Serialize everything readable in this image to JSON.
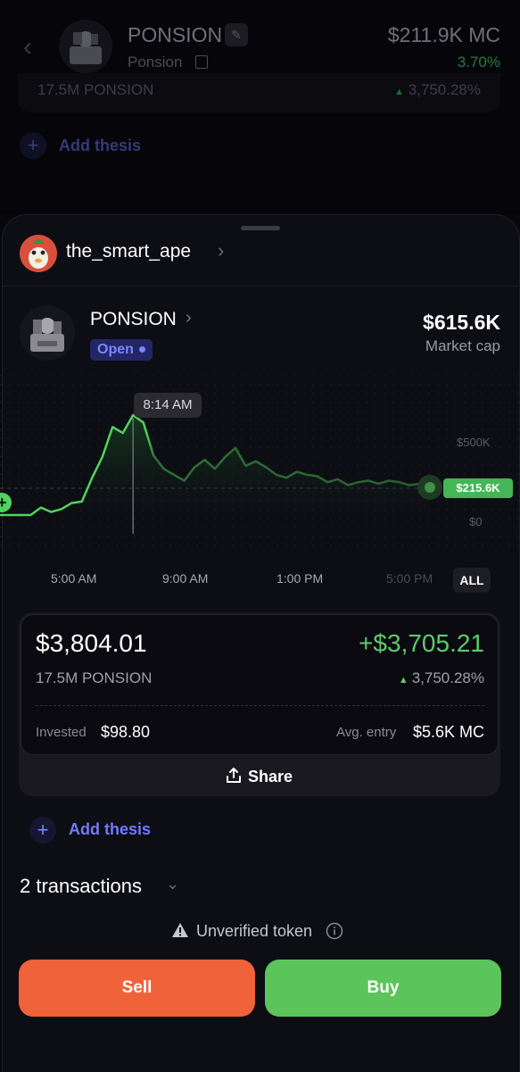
{
  "background": {
    "token_name": "PONSION",
    "ticker": "Ponsion",
    "market_cap": "$211.9K MC",
    "change_pct": "3.70%",
    "position_amount": "17.5M PONSION",
    "position_gain": "3,750.28%",
    "add_thesis": "Add thesis"
  },
  "sheet": {
    "username": "the_smart_ape",
    "token": {
      "name": "PONSION",
      "status": "Open",
      "market_cap_value": "$615.6K",
      "market_cap_label": "Market cap"
    },
    "chart": {
      "tooltip_time": "8:14 AM",
      "y_labels": [
        "$500K",
        "$0"
      ],
      "current_price": "$215.6K",
      "x_labels": [
        "5:00 AM",
        "9:00 AM",
        "1:00 PM",
        "5:00 PM"
      ],
      "range_button": "ALL",
      "accent_color": "#5bc45a"
    },
    "position": {
      "value": "$3,804.01",
      "pnl": "+$3,705.21",
      "amount": "17.5M PONSION",
      "pnl_pct": "3,750.28%",
      "invested_label": "Invested",
      "invested_value": "$98.80",
      "avg_entry_label": "Avg. entry",
      "avg_entry_value": "$5.6K MC",
      "share_label": "Share"
    },
    "add_thesis": "Add thesis",
    "transactions": "2 transactions",
    "unverified": "Unverified token",
    "sell": "Sell",
    "buy": "Buy"
  },
  "chart_data": {
    "type": "line",
    "x_ticks": [
      "5:00 AM",
      "9:00 AM",
      "1:00 PM",
      "5:00 PM"
    ],
    "y_ticks": [
      "$0",
      "$500K"
    ],
    "current_value_label": "$215.6K",
    "highlight_label": "8:14 AM",
    "series": [
      {
        "values": [
          30,
          30,
          30,
          30,
          80,
          50,
          70,
          110,
          120,
          280,
          420,
          620,
          580,
          700,
          650,
          430,
          340,
          300,
          260,
          350,
          400,
          340,
          420,
          480,
          360,
          390,
          350,
          300,
          280,
          320,
          300,
          290,
          250,
          270,
          230,
          250,
          260,
          240,
          260,
          250,
          230,
          240,
          215.6
        ]
      }
    ]
  }
}
